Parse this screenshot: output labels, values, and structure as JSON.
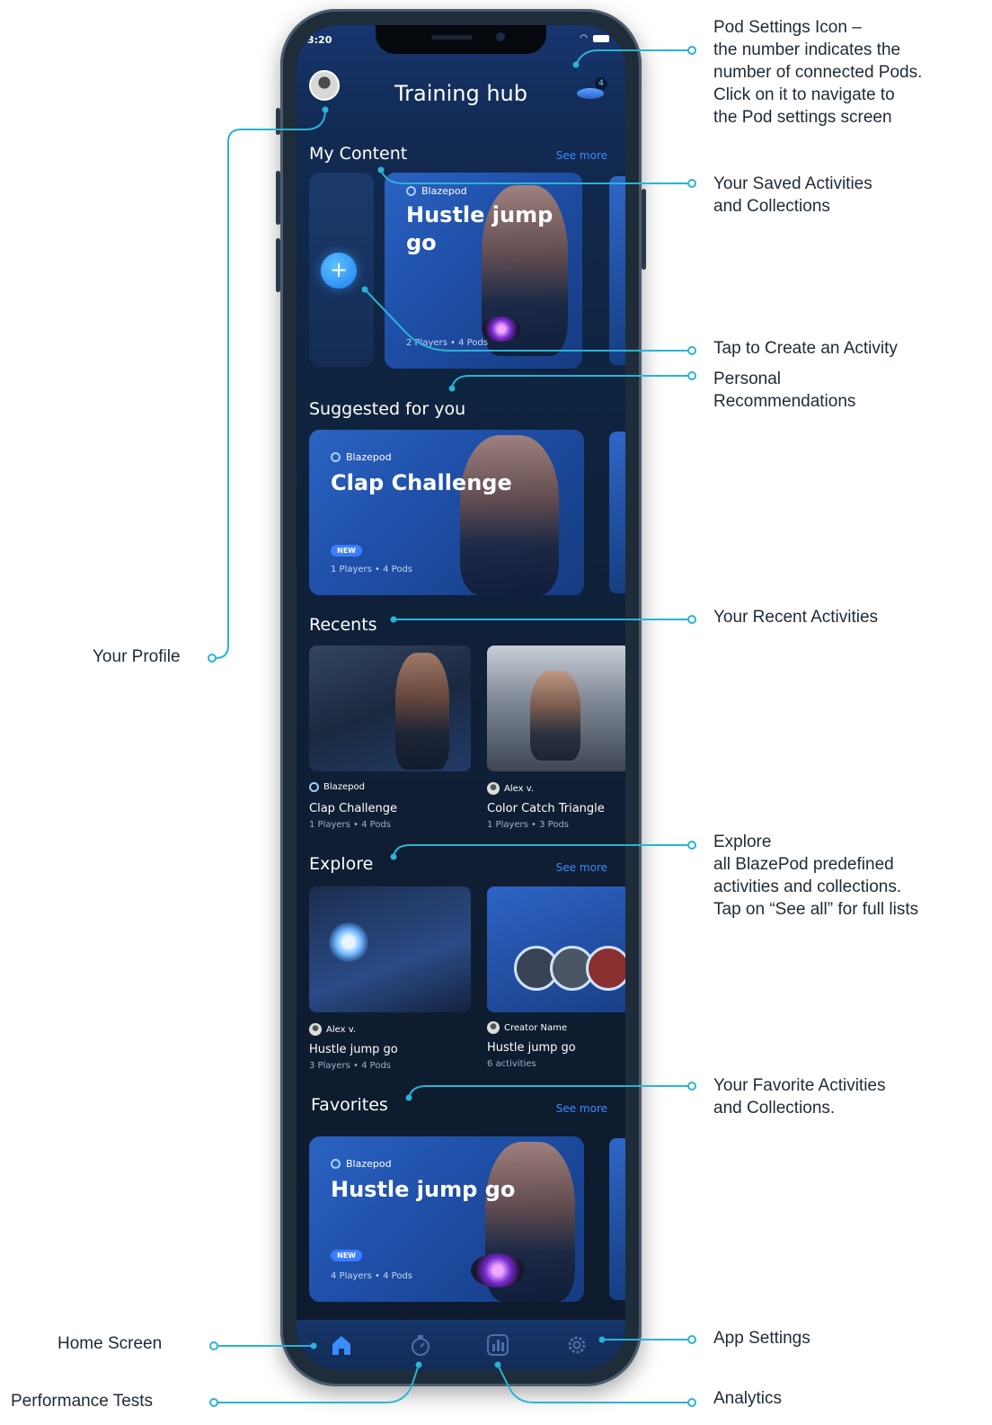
{
  "status": {
    "time": "3:20"
  },
  "header": {
    "title": "Training hub",
    "pod_count": "4"
  },
  "my_content": {
    "title": "My Content",
    "see_more": "See more",
    "card": {
      "author": "Blazepod",
      "title_line1": "Hustle jump",
      "title_line2": "go",
      "meta": "2 Players • 4 Pods"
    },
    "create_label": "+"
  },
  "suggested": {
    "title": "Suggested for you",
    "card": {
      "author": "Blazepod",
      "title": "Clap Challenge",
      "badge": "NEW",
      "meta": "1 Players • 4 Pods"
    }
  },
  "recents": {
    "title": "Recents",
    "items": [
      {
        "author": "Blazepod",
        "title": "Clap Challenge",
        "meta": "1 Players • 4 Pods"
      },
      {
        "author": "Alex v.",
        "title": "Color Catch Triangle",
        "meta": "1 Players • 3 Pods"
      }
    ]
  },
  "explore": {
    "title": "Explore",
    "see_more": "See more",
    "items": [
      {
        "author": "Alex v.",
        "title": "Hustle jump go",
        "meta": "3 Players • 4 Pods"
      },
      {
        "author": "Creator Name",
        "title": "Hustle jump go",
        "meta": "6 activities"
      }
    ]
  },
  "favorites": {
    "title": "Favorites",
    "see_more": "See more",
    "card": {
      "author": "Blazepod",
      "title": "Hustle jump go",
      "badge": "NEW",
      "meta": "4 Players • 4 Pods"
    }
  },
  "annotations": {
    "pod_settings": [
      "Pod Settings Icon –",
      "the number indicates the",
      "number of connected Pods.",
      "Click on it to navigate to",
      "the Pod settings screen"
    ],
    "saved": [
      "Your Saved Activities",
      "and Collections"
    ],
    "create": [
      "Tap to Create an Activity"
    ],
    "recommend": [
      "Personal",
      "Recommendations"
    ],
    "recent": [
      "Your Recent Activities"
    ],
    "explore": [
      "Explore",
      "all BlazePod predefined",
      "activities and collections.",
      "Tap on “See all” for full lists"
    ],
    "favorite": [
      "Your Favorite Activities",
      "and Collections."
    ],
    "profile": "Your Profile",
    "home": "Home Screen",
    "performance": "Performance Tests",
    "app_settings": "App Settings",
    "analytics": "Analytics"
  },
  "colors": {
    "accent_line": "#2ab3d6",
    "link_blue": "#3b8cff",
    "card_blue": "#2b63c2"
  },
  "icons": {
    "home": "home-icon",
    "stopwatch": "stopwatch-icon",
    "analytics": "bar-chart-icon",
    "settings": "gear-icon"
  }
}
